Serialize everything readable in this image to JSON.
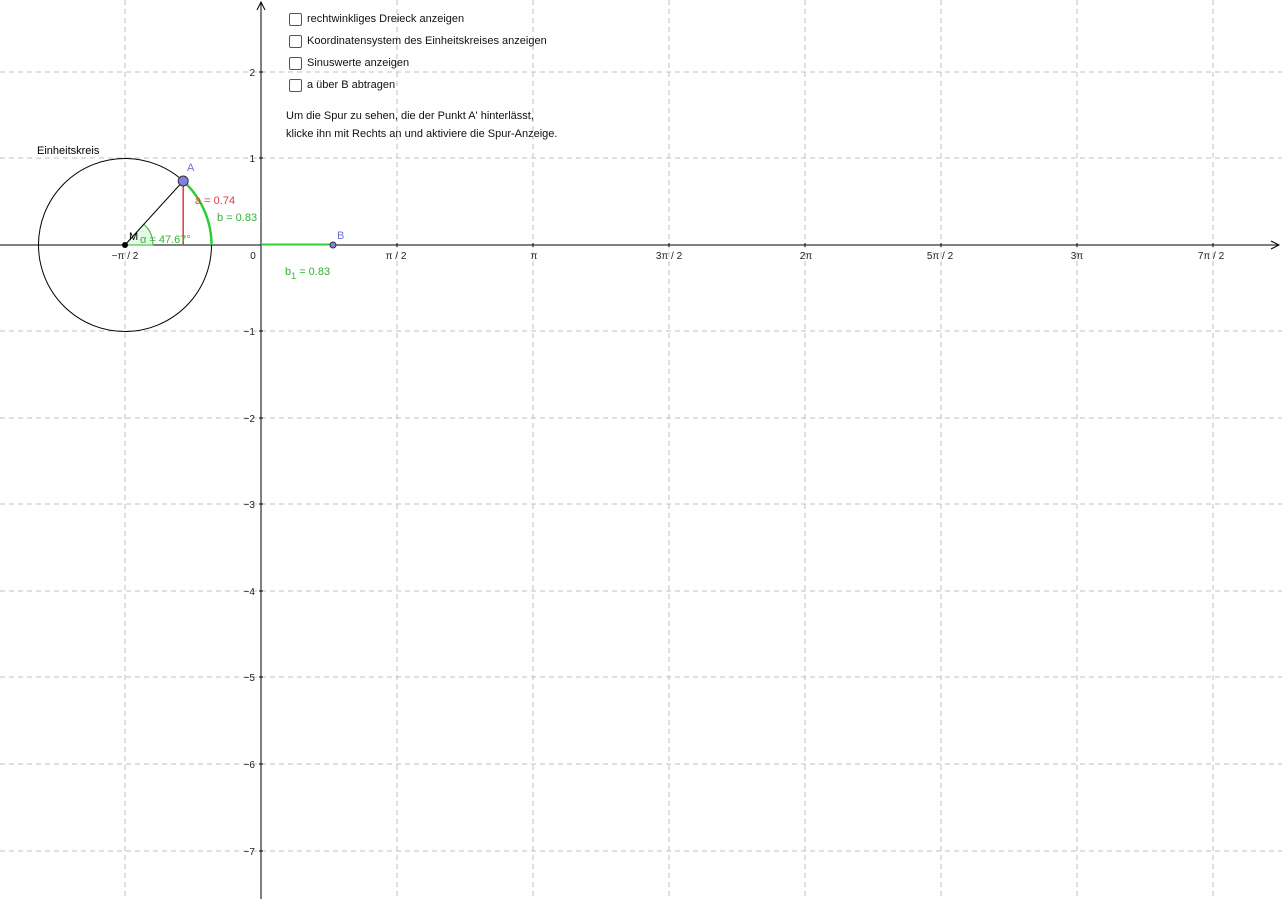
{
  "checkboxes": [
    {
      "label": "rechtwinkliges Dreieck anzeigen",
      "checked": false
    },
    {
      "label": "Koordinatensystem des Einheitskreises anzeigen",
      "checked": false
    },
    {
      "label": "Sinuswerte anzeigen",
      "checked": false
    },
    {
      "label": "a über B abtragen",
      "checked": false
    }
  ],
  "info": {
    "line1": "Um die Spur zu sehen, die der Punkt A' hinterlässt,",
    "line2": "klicke ihn mit Rechts an und aktiviere die Spur-Anzeige."
  },
  "graph": {
    "x_ticks": [
      "−π / 2",
      "0",
      "π / 2",
      "π",
      "3π / 2",
      "2π",
      "5π / 2",
      "3π",
      "7π / 2"
    ],
    "y_ticks": [
      "2",
      "1",
      "−1",
      "−2",
      "−3",
      "−4",
      "−5",
      "−6",
      "−7"
    ],
    "circle_label": "Einheitskreis",
    "point_A": "A",
    "point_B": "B",
    "point_M": "M",
    "label_a": "a = 0.74",
    "label_b": "b = 0.83",
    "label_alpha": "α = 47.67°",
    "label_b1_main": "b",
    "label_b1_sub": "1",
    "label_b1_value": " = 0.83",
    "colors": {
      "point": "#8080e0",
      "point_label": "#7070d0",
      "a_segment": "#e0393e",
      "arc": "#33cc33",
      "angle_label": "#2fb52f"
    }
  }
}
